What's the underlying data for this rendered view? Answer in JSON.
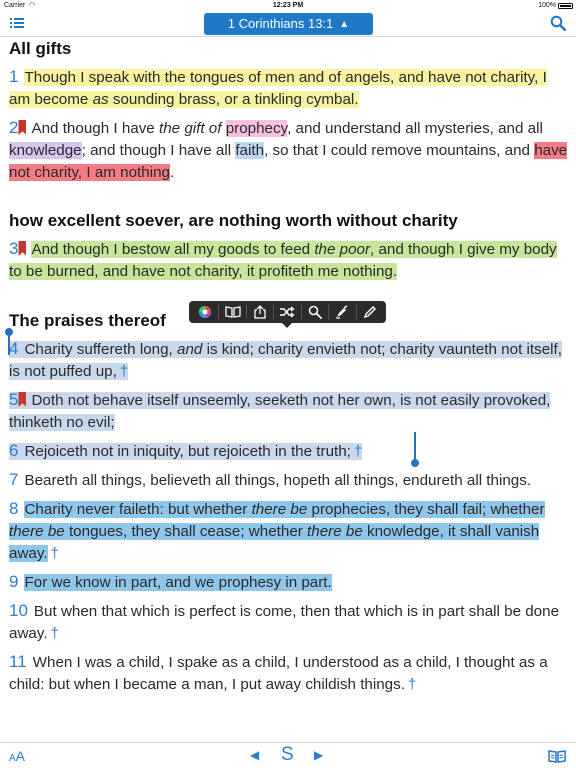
{
  "status": {
    "carrier": "Carrier",
    "time": "12:23 PM",
    "battery": "100%"
  },
  "nav": {
    "reference": "1 Corinthians 13:1"
  },
  "sections": {
    "s1": "All gifts",
    "s2": "how excellent soever, are nothing worth without charity",
    "s3": "The praises thereof"
  },
  "verses": {
    "v1": {
      "num": "1",
      "text": "Though I speak with the tongues of men and of angels, and have not charity, I am become ",
      "italic": "as",
      "text_b": " sounding brass, or a tinkling cymbal."
    },
    "v2": {
      "num": "2",
      "a": "And though I have ",
      "italic1": "the gift of",
      "b": " ",
      "prophecy": "prophecy",
      "c": ", and understand all mysteries, and all ",
      "knowledge": "knowledge",
      "d": "; and though I have all ",
      "faith": "faith",
      "e": ", so that I could remove mountains, and ",
      "red": "have not charity, I am nothing",
      "f": "."
    },
    "v3": {
      "num": "3",
      "a": "And though I bestow all my goods to feed ",
      "italic": "the poor",
      "b": ", and though I give my body to be burned, and have not charity, it profiteth me nothing."
    },
    "v4": {
      "num": "4",
      "a": "Charity suffereth long, ",
      "italic": "and",
      "b": " is kind; charity envieth not; charity vaunteth not itself, is not puffed up,"
    },
    "v5": {
      "num": "5",
      "text": "Doth not behave itself unseemly, seeketh not her own, is not easily provoked, thinketh no evil;"
    },
    "v6": {
      "num": "6",
      "text": "Rejoiceth not in iniquity, but rejoiceth in the truth;"
    },
    "v7": {
      "num": "7",
      "text": "Beareth all things, believeth all things, hopeth all things, endureth all things."
    },
    "v8": {
      "num": "8",
      "a": "Charity never faileth: but whether ",
      "i1": "there be",
      "b": " prophecies, they shall fail; whether ",
      "i2": "there be",
      "c": " tongues, they shall cease; whether ",
      "i3": "there be",
      "d": " knowledge, it shall vanish away."
    },
    "v9": {
      "num": "9",
      "text": "For we know in part, and we prophesy in part."
    },
    "v10": {
      "num": "10",
      "text": "But when that which is perfect is come, then that which is in part shall be done away."
    },
    "v11": {
      "num": "11",
      "text": "When I was a child, I spake as a child, I understood as a child, I thought as a child: but when I became a man, I put away childish things."
    }
  },
  "xref_symbol": "†",
  "bottom": {
    "font_small": "A",
    "font_large": "A",
    "prev": "◀",
    "strongs": "S",
    "next": "▶"
  },
  "icons": {
    "menu": "list-icon",
    "search": "search-icon",
    "color": "color-wheel-icon",
    "book": "book-icon",
    "share": "share-icon",
    "shuffle": "shuffle-icon",
    "lookup": "magnifier-icon",
    "highlight": "highlighter-icon",
    "note": "pencil-icon",
    "library": "open-book-icon"
  },
  "colors": {
    "accent": "#1f78c8",
    "highlight_yellow": "#f7f3a0",
    "highlight_green": "#c6e69b",
    "highlight_red": "#f47c85",
    "highlight_cyan": "#8fc6ec",
    "highlight_purple": "#d9c4f0",
    "highlight_pink": "#f7c0e0",
    "selection": "#c9d8ea"
  }
}
